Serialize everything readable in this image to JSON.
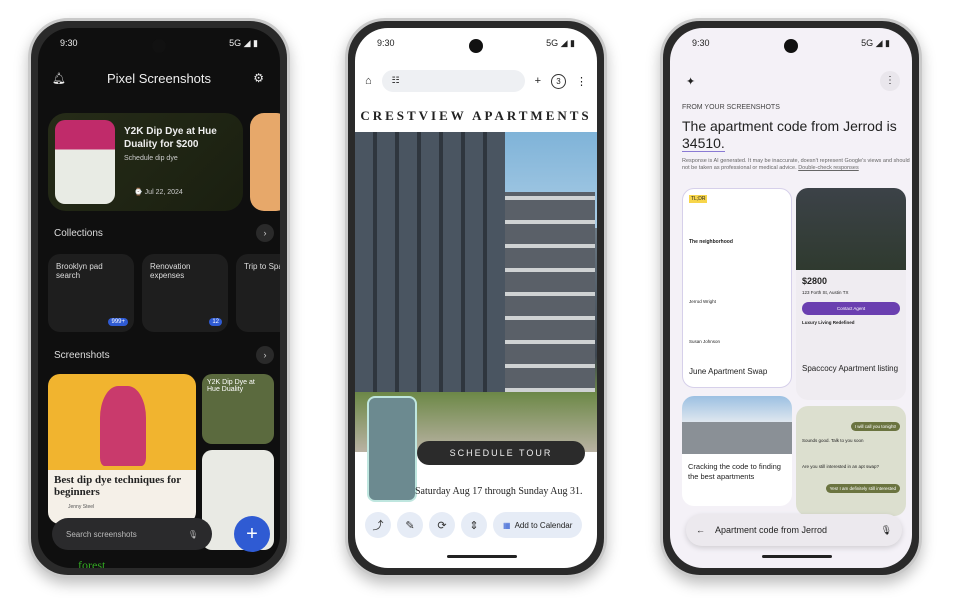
{
  "phone1": {
    "time": "9:30",
    "signal": "5G",
    "title": "Pixel Screenshots",
    "hero": {
      "title": "Y2K Dip Dye at Hue Duality for $200",
      "action": "Schedule dip dye",
      "date": "Jul 22, 2024"
    },
    "collections_label": "Collections",
    "collections": [
      {
        "label": "Brooklyn pad search",
        "count": "999+"
      },
      {
        "label": "Renovation expenses",
        "count": "12"
      },
      {
        "label": "Trip to Spain"
      }
    ],
    "screenshots_label": "Screenshots",
    "shots": {
      "big_title": "Best dip dye techniques for beginners",
      "big_author": "Jenny Steel",
      "small_title": "Y2K Dip Dye at Hue Duality",
      "forest": "forest"
    },
    "search_placeholder": "Search screenshots",
    "fab": "+"
  },
  "phone2": {
    "time": "9:30",
    "signal": "5G",
    "tab_count": "3",
    "title": "CRESTVIEW APARTMENTS",
    "cta": "SCHEDULE TOUR",
    "dates": "Saturday Aug 17 through Sunday Aug 31.",
    "add_calendar": "Add to Calendar"
  },
  "phone3": {
    "time": "9:30",
    "signal": "5G",
    "eyebrow": "FROM YOUR SCREENSHOTS",
    "answer": "The apartment code from Jerrod is",
    "code": "34510.",
    "disclaimer": "Response is AI generated. It may be inaccurate, doesn't represent Google's views and should not be taken as professional or medical advice.",
    "double_check": "Double-check responses",
    "tldr": "TL;DR",
    "neighborhood": "The neighborhood",
    "cards": [
      {
        "title": "June Apartment Swap",
        "sender": "Jerrod Wright",
        "reply": "Susan Johnson"
      },
      {
        "title": "Spaccocy Apartment listing",
        "price": "$2800",
        "address": "123 Forth St, Austin TX",
        "button": "Contact Agent",
        "heading": "Luxury Living Redefined"
      },
      {
        "title": "Cracking the code to finding the best apartments"
      }
    ],
    "chat": [
      "I will call you tonight!",
      "Sounds good. Talk to you soon",
      "Are you still interested in an apt swap?",
      "Yes! I am definitely still interested"
    ],
    "query": "Apartment code from Jerrod"
  },
  "colors": {
    "accent_blue": "#2f5bd3",
    "purple": "#6a3fb0",
    "olive": "#6b7440"
  }
}
